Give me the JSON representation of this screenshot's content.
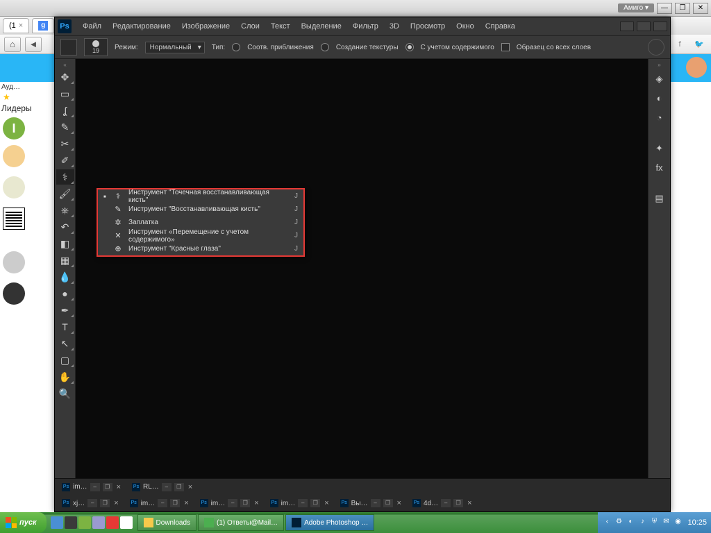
{
  "browser": {
    "amigo_label": "Амиго ▾",
    "tab_label": "(1",
    "tab_close": "×"
  },
  "page": {
    "aud_text": "Ауд…",
    "lidery": "Лидеры",
    "avatar_i": "I"
  },
  "ps": {
    "logo": "Ps",
    "menu": [
      "Файл",
      "Редактирование",
      "Изображение",
      "Слои",
      "Текст",
      "Выделение",
      "Фильтр",
      "3D",
      "Просмотр",
      "Окно",
      "Справка"
    ],
    "options": {
      "brush_size": "19",
      "mode_label": "Режим:",
      "mode_value": "Нормальный",
      "type_label": "Тип:",
      "radio1": "Соотв. приближения",
      "radio2": "Создание текстуры",
      "radio3": "С учетом содержимого",
      "sample_all": "Образец со всех слоев"
    },
    "flyout": [
      {
        "icon": "⚕",
        "label": "Инструмент \"Точечная восстанавливающая кисть\"",
        "key": "J",
        "active": true
      },
      {
        "icon": "✎",
        "label": "Инструмент \"Восстанавливающая кисть\"",
        "key": "J"
      },
      {
        "icon": "✲",
        "label": "Заплатка",
        "key": "J"
      },
      {
        "icon": "✕",
        "label": "Инструмент «Перемещение с учетом содержимого»",
        "key": "J"
      },
      {
        "icon": "⊕",
        "label": "Инструмент \"Красные глаза\"",
        "key": "J"
      }
    ],
    "doc_tabs_top": [
      {
        "label": "im…"
      },
      {
        "label": "RL…"
      }
    ],
    "doc_tabs_bottom": [
      {
        "label": "xj…"
      },
      {
        "label": "im…"
      },
      {
        "label": "im…"
      },
      {
        "label": "im…"
      },
      {
        "label": "Вы…"
      },
      {
        "label": "4d…"
      }
    ]
  },
  "taskbar": {
    "start": "пуск",
    "items": [
      {
        "label": "Downloads",
        "color": "#f7c94b"
      },
      {
        "label": "(1) Ответы@Mail…",
        "color": "#4caf50"
      },
      {
        "label": "Adobe Photoshop …",
        "color": "#001e36",
        "active": true
      }
    ],
    "clock": "10:25"
  }
}
